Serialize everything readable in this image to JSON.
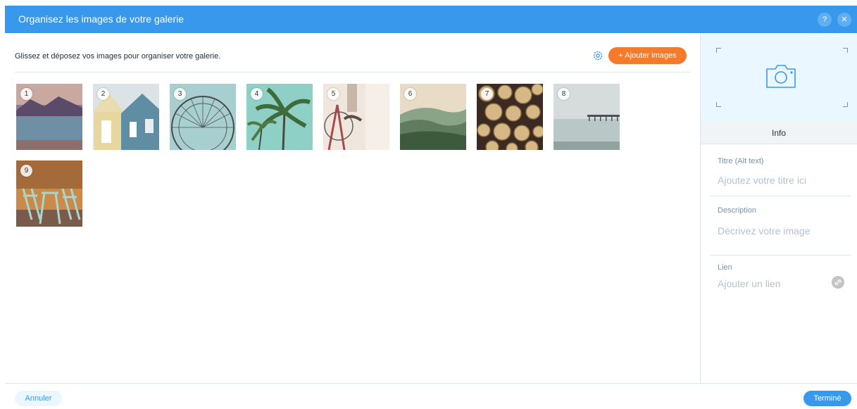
{
  "header": {
    "title": "Organisez les images de votre galerie",
    "help_label": "?",
    "close_label": "✕"
  },
  "toolbar": {
    "instruction": "Glissez et déposez vos images pour organiser votre galerie.",
    "add_button": "+ Ajouter images",
    "gear_icon": "gear-icon"
  },
  "gallery": {
    "items": [
      {
        "number": "1",
        "subject": "lake-mountains"
      },
      {
        "number": "2",
        "subject": "colorful-houses"
      },
      {
        "number": "3",
        "subject": "ferris-wheel"
      },
      {
        "number": "4",
        "subject": "palm-trees"
      },
      {
        "number": "5",
        "subject": "bicycle"
      },
      {
        "number": "6",
        "subject": "green-hills"
      },
      {
        "number": "7",
        "subject": "wood-logs"
      },
      {
        "number": "8",
        "subject": "foggy-pier"
      },
      {
        "number": "9",
        "subject": "cafe-chairs"
      }
    ]
  },
  "sidebar": {
    "info_tab": "Info",
    "title_label": "Titre (Alt text)",
    "title_placeholder": "Ajoutez votre titre ici",
    "description_label": "Description",
    "description_placeholder": "Décrivez votre image",
    "link_label": "Lien",
    "link_placeholder": "Ajouter un lien"
  },
  "footer": {
    "cancel": "Annuler",
    "done": "Terminé"
  },
  "colors": {
    "primary": "#3899ec",
    "accent": "#f57a2b"
  }
}
